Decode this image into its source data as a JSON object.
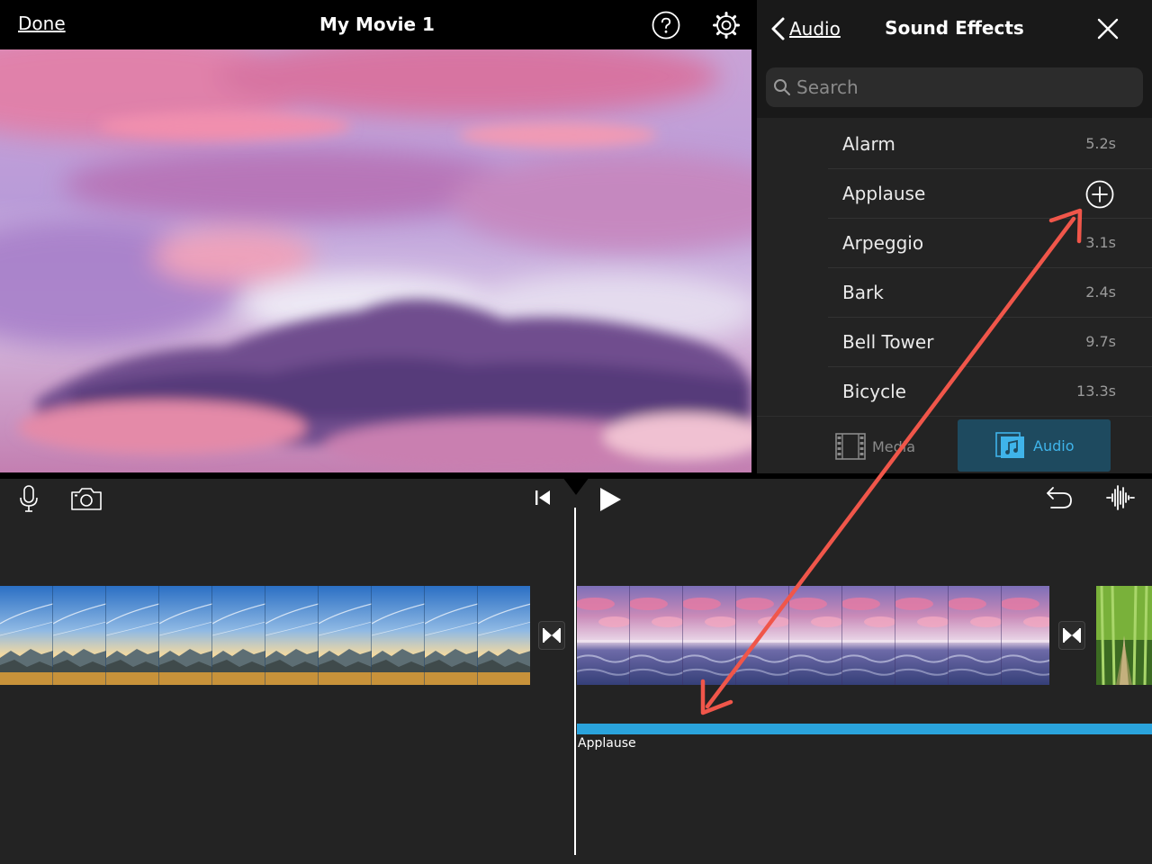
{
  "header": {
    "done_label": "Done",
    "title": "My Movie 1"
  },
  "browser": {
    "back_label": "Audio",
    "title": "Sound Effects",
    "search_placeholder": "Search",
    "sounds": [
      {
        "name": "Alarm",
        "duration": "5.2s"
      },
      {
        "name": "Applause",
        "duration": ""
      },
      {
        "name": "Arpeggio",
        "duration": "3.1s"
      },
      {
        "name": "Bark",
        "duration": "2.4s"
      },
      {
        "name": "Bell Tower",
        "duration": "9.7s"
      },
      {
        "name": "Bicycle",
        "duration": "13.3s"
      }
    ],
    "tabs": {
      "media_label": "Media",
      "audio_label": "Audio"
    }
  },
  "timeline": {
    "audio_clip_label": "Applause"
  },
  "colors": {
    "accent": "#2aa3dc",
    "active_tab_bg": "#1e4a5f",
    "annotation_arrow": "#f0564a"
  },
  "icons": [
    "help-icon",
    "gear-icon",
    "chevron-left-icon",
    "close-icon",
    "search-icon",
    "add-icon",
    "film-icon",
    "music-note-icon",
    "microphone-icon",
    "camera-icon",
    "skip-back-icon",
    "play-icon",
    "undo-icon",
    "waveform-icon",
    "transition-icon"
  ]
}
